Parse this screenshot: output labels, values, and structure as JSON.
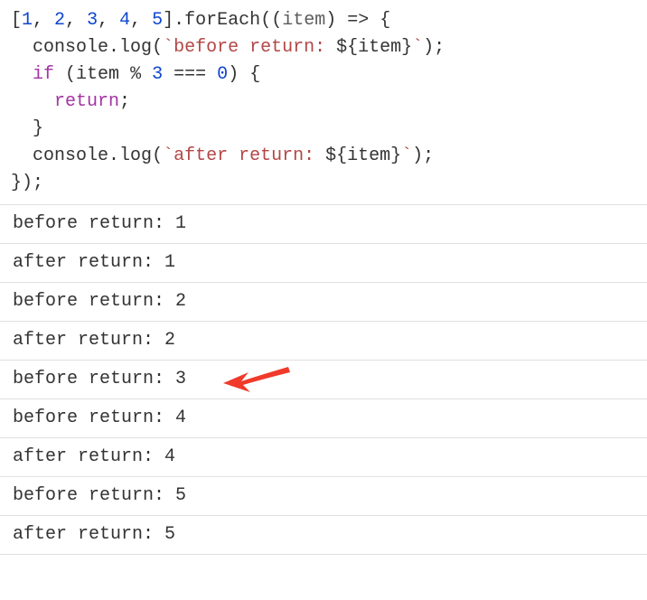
{
  "code": {
    "array": [
      "1",
      "2",
      "3",
      "4",
      "5"
    ],
    "method": "forEach",
    "param": "item",
    "obj": "console",
    "fn": "log",
    "str_before_a": "`before return: ",
    "str_before_b": "`",
    "templ_open": "${",
    "templ_var": "item",
    "templ_close": "}",
    "kw_if": "if",
    "cond_var": "item",
    "cond_op": "%",
    "cond_num": "3",
    "cond_eq": "===",
    "cond_zero": "0",
    "kw_return": "return",
    "str_after_a": "`after return: ",
    "str_after_b": "`"
  },
  "output": [
    "before return: 1",
    "after return: 1",
    "before return: 2",
    "after return: 2",
    "before return: 3",
    "before return: 4",
    "after return: 4",
    "before return: 5",
    "after return: 5"
  ],
  "highlight_index": 4
}
